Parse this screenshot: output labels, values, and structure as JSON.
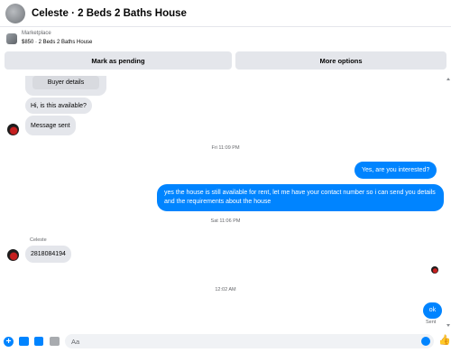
{
  "header": {
    "title": "Celeste · 2 Beds 2 Baths House",
    "avatar_icon": "user-avatar"
  },
  "listing": {
    "source": "Marketplace",
    "detail": "$850 · 2 Beds 2 Baths House",
    "mark_pending": "Mark as pending",
    "more_options": "More options"
  },
  "messages": {
    "buyer_details": "Buyer details",
    "available_q": "Hi, is this available?",
    "message_sent": "Message sent",
    "ts1": "Fri 11:09 PM",
    "out1": "Yes, are you interested?",
    "out2": "yes the house is still available for rent, let me have your contact number so i can send you details and the requirements about the house",
    "ts2": "Sat 11:06 PM",
    "sender": "Celeste",
    "phone": "2818084194",
    "ts3": "12:02 AM",
    "out3": "ok",
    "status": "Sent"
  },
  "composer": {
    "placeholder": "Aa",
    "like_glyph": "👍"
  },
  "colors": {
    "accent": "#0084ff",
    "bubble_in": "#e4e6eb",
    "button_bg": "#e4e6eb"
  }
}
